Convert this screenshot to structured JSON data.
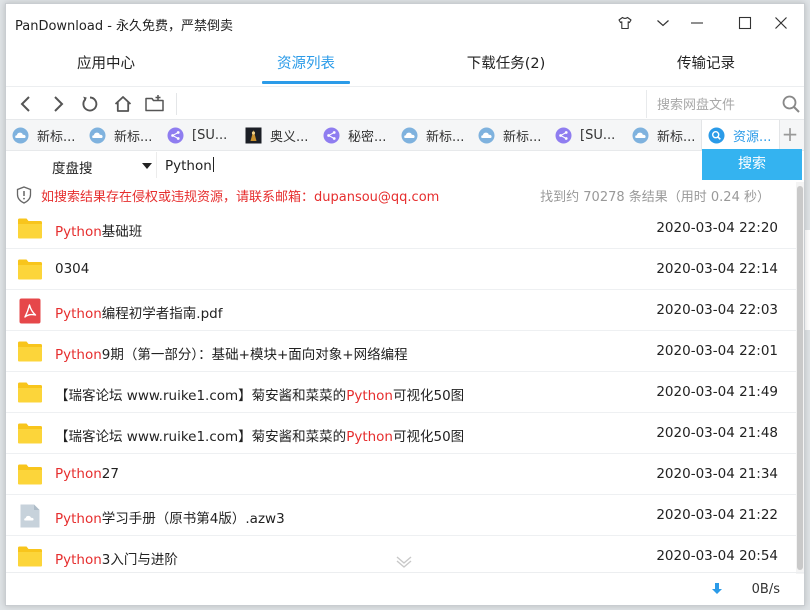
{
  "window": {
    "title": "PanDownload - 永久免费，严禁倒卖"
  },
  "nav_tabs": [
    {
      "label": "应用中心",
      "active": false
    },
    {
      "label": "资源列表",
      "active": true
    },
    {
      "label": "下载任务(2)",
      "active": false
    },
    {
      "label": "传输记录",
      "active": false
    }
  ],
  "toolbar": {
    "search_placeholder": "搜索网盘文件"
  },
  "browser_tabs": [
    {
      "label": "新标...",
      "icon": "cloud-icon"
    },
    {
      "label": "新标...",
      "icon": "cloud-icon"
    },
    {
      "label": "[SU...",
      "icon": "share-icon"
    },
    {
      "label": "奥义...",
      "icon": "thumbnail-icon"
    },
    {
      "label": "秘密...",
      "icon": "share-icon"
    },
    {
      "label": "新标...",
      "icon": "cloud-icon"
    },
    {
      "label": "新标...",
      "icon": "cloud-icon"
    },
    {
      "label": "[SU...",
      "icon": "share-icon"
    },
    {
      "label": "新标...",
      "icon": "cloud-icon"
    },
    {
      "label": "资源...",
      "icon": "search-icon",
      "active": true
    }
  ],
  "search": {
    "engine": "度盘搜",
    "query": "Python",
    "button": "搜索"
  },
  "notice": {
    "warning": "如搜索结果存在侵权或违规资源，请联系邮箱：dupansou@qq.com",
    "result_count": "找到约 70278 条结果（用时 0.24 秒）"
  },
  "results": [
    {
      "icon": "folder-icon",
      "pre": "",
      "hl": "Python",
      "post": "基础班",
      "date": "2020-03-04 22:20"
    },
    {
      "icon": "folder-icon",
      "pre": "0304",
      "hl": "",
      "post": "",
      "date": "2020-03-04 22:14"
    },
    {
      "icon": "pdf-icon",
      "pre": "",
      "hl": "Python",
      "post": "编程初学者指南.pdf",
      "date": "2020-03-04 22:03"
    },
    {
      "icon": "folder-icon",
      "pre": "",
      "hl": "Python",
      "post": "9期（第一部分）：基础+模块+面向对象+网络编程",
      "date": "2020-03-04 22:01"
    },
    {
      "icon": "folder-icon",
      "pre": "【瑞客论坛 www.ruike1.com】菊安酱和菜菜的",
      "hl": "Python",
      "post": "可视化50图",
      "date": "2020-03-04 21:49"
    },
    {
      "icon": "folder-icon",
      "pre": "【瑞客论坛 www.ruike1.com】菊安酱和菜菜的",
      "hl": "Python",
      "post": "可视化50图",
      "date": "2020-03-04 21:48"
    },
    {
      "icon": "folder-icon",
      "pre": "",
      "hl": "Python",
      "post": "27",
      "date": "2020-03-04 21:34"
    },
    {
      "icon": "file-icon",
      "pre": "",
      "hl": "Python",
      "post": "学习手册（原书第4版）.azw3",
      "date": "2020-03-04 21:22"
    },
    {
      "icon": "folder-icon",
      "pre": "",
      "hl": "Python",
      "post": "3入门与进阶",
      "date": "2020-03-04 20:54"
    }
  ],
  "status": {
    "speed": "0B/s"
  },
  "colors": {
    "accent": "#2b9be8",
    "search_button": "#34b3f0",
    "highlight": "#e62e2e",
    "folder": "#f8c51c"
  }
}
